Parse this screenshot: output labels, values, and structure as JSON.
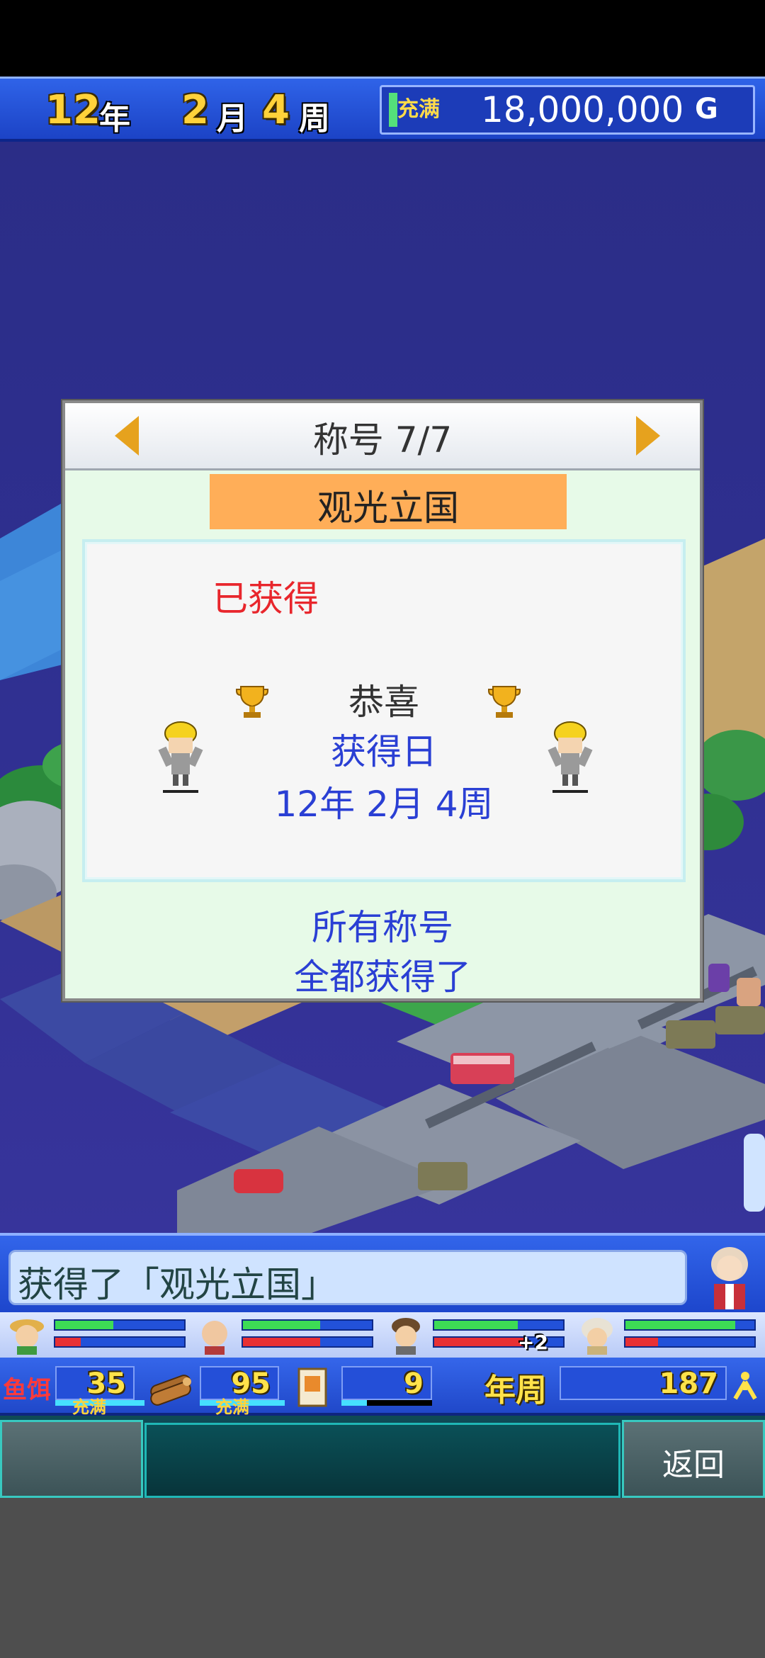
{
  "hud": {
    "year_num": "12",
    "year_unit": "年",
    "month_num": "2",
    "month_unit": "月",
    "week_num": "4",
    "week_unit": "周",
    "money_label": "充满",
    "money_amount": "18,000,000",
    "money_unit": "G"
  },
  "dialog": {
    "title": "称号 7/7",
    "title_name": "观光立国",
    "obtained": "已获得",
    "congrats": "恭喜",
    "date_label": "获得日",
    "date_value": "12年 2月 4周",
    "all_titles_line1": "所有称号",
    "all_titles_line2": "全都获得了"
  },
  "message": {
    "text": "获得了「观光立国」"
  },
  "staff": [
    {
      "name": "staff-1",
      "green": 0.45,
      "red": 0.2
    },
    {
      "name": "staff-2",
      "green": 0.6,
      "red": 0.6
    },
    {
      "name": "staff-3",
      "green": 0.65,
      "red": 0.7,
      "bonus": "+2"
    },
    {
      "name": "staff-4",
      "green": 0.85,
      "red": 0.25
    }
  ],
  "resources": {
    "food_label": "鱼饵",
    "food_value": "35",
    "food_sub": "充满",
    "wood_value": "95",
    "wood_sub": "充满",
    "doc_value": "9",
    "period_label": "年周",
    "population_value": "187",
    "population_icon": "person-icon"
  },
  "nav": {
    "back_label": "返回"
  },
  "colors": {
    "accent_blue": "#2a3fd4",
    "title_orange": "#ffae58",
    "obtained_red": "#e8262c",
    "hud_blue": "#2f63e8"
  }
}
